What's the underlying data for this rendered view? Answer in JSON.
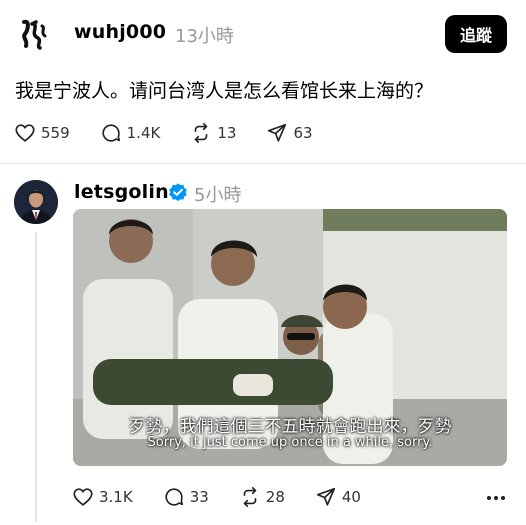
{
  "post1": {
    "username": "wuhj000",
    "time": "13小時",
    "follow_label": "追蹤",
    "text": "我是宁波人。请问台湾人是怎么看馆长来上海的？",
    "likes": "559",
    "replies": "1.4K",
    "reposts": "13",
    "shares": "63"
  },
  "post2": {
    "username": "letsgolin",
    "time": "5小時",
    "subtitle_zh": "歹勢，我們這個三不五時就會跑出來，歹勢",
    "subtitle_en": "Sorry, it just come up once in a while, sorry.",
    "likes": "3.1K",
    "replies": "33",
    "reposts": "28",
    "shares": "40"
  },
  "colors": {
    "verified": "#0095f6",
    "muted": "#999999",
    "button": "#000000"
  },
  "icons": [
    "heart-icon",
    "comment-icon",
    "repost-icon",
    "share-icon",
    "verified-badge-icon",
    "more-icon"
  ]
}
